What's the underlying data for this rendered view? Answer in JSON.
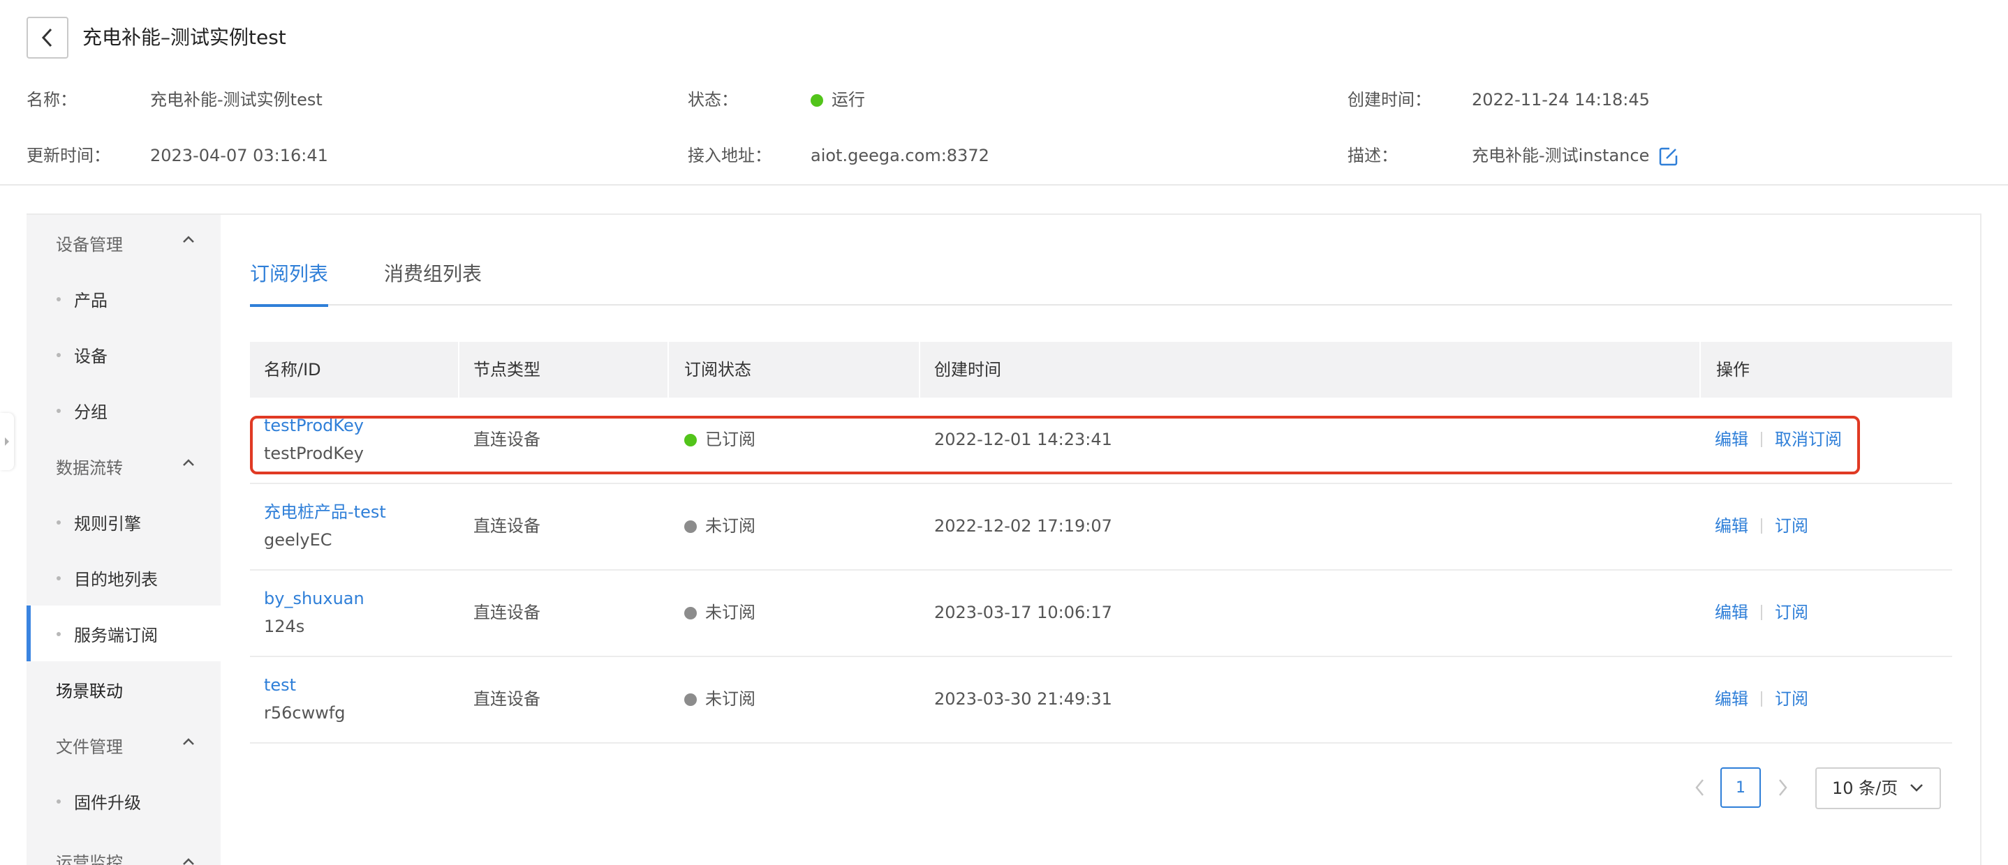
{
  "header": {
    "title": "充电补能–测试实例test",
    "info": {
      "name_label": "名称：",
      "name_value": "充电补能-测试实例test",
      "status_label": "状态：",
      "status_value": "运行",
      "created_label": "创建时间：",
      "created_value": "2022-11-24 14:18:45",
      "updated_label": "更新时间：",
      "updated_value": "2023-04-07 03:16:41",
      "endpoint_label": "接入地址：",
      "endpoint_value": "aiot.geega.com:8372",
      "desc_label": "描述：",
      "desc_value": "充电补能-测试instance"
    }
  },
  "sidebar": {
    "device_group": "设备管理",
    "product": "产品",
    "device": "设备",
    "group": "分组",
    "data_group": "数据流转",
    "rule_engine": "规则引擎",
    "destination_list": "目的地列表",
    "server_subscription": "服务端订阅",
    "scene_linkage": "场景联动",
    "file_group": "文件管理",
    "firmware_upgrade": "固件升级",
    "ops_group": "运营监控"
  },
  "tabs": {
    "subscription_list": "订阅列表",
    "consumer_group_list": "消费组列表"
  },
  "table": {
    "headers": {
      "name_id": "名称/ID",
      "node_type": "节点类型",
      "sub_status": "订阅状态",
      "created_time": "创建时间",
      "operation": "操作"
    },
    "rows": [
      {
        "name": "testProdKey",
        "id": "testProdKey",
        "node_type": "直连设备",
        "status": "已订阅",
        "created": "2022-12-01 14:23:41",
        "op1": "编辑",
        "op2": "取消订阅"
      },
      {
        "name": "充电桩产品-test",
        "id": "geelyEC",
        "node_type": "直连设备",
        "status": "未订阅",
        "created": "2022-12-02 17:19:07",
        "op1": "编辑",
        "op2": "订阅"
      },
      {
        "name": "by_shuxuan",
        "id": "124s",
        "node_type": "直连设备",
        "status": "未订阅",
        "created": "2023-03-17 10:06:17",
        "op1": "编辑",
        "op2": "订阅"
      },
      {
        "name": "test",
        "id": "r56cwwfg",
        "node_type": "直连设备",
        "status": "未订阅",
        "created": "2023-03-30 21:49:31",
        "op1": "编辑",
        "op2": "订阅"
      }
    ]
  },
  "pagination": {
    "current_page": "1",
    "page_size": "10 条/页"
  },
  "colors": {
    "accent": "#2f7fd8",
    "running": "#52c41a",
    "subscribed": "#52c41a",
    "unsubscribed": "#8c8c8c",
    "highlight": "#e03a24"
  },
  "icons": {
    "back": "chevron-left-icon",
    "edit": "edit-icon",
    "collapse": "chevron-up-icon",
    "prev": "chevron-left-icon",
    "next": "chevron-right-icon",
    "dropdown": "chevron-down-icon"
  }
}
